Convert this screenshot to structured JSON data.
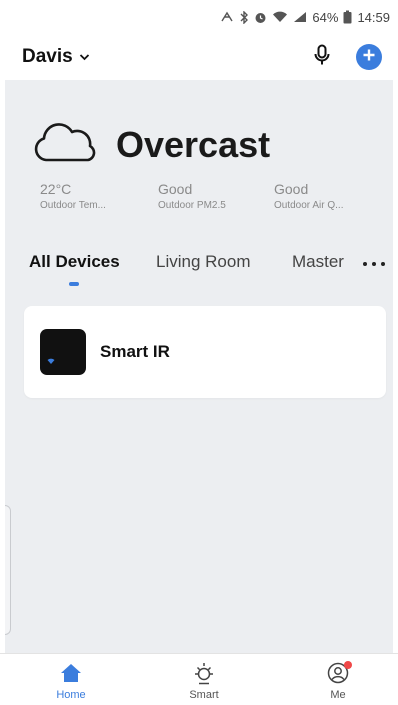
{
  "status_bar": {
    "battery_percent": "64%",
    "time": "14:59",
    "icons": [
      "nfc-icon",
      "bluetooth-icon",
      "alarm-icon",
      "wifi-icon",
      "signal-icon",
      "battery-icon"
    ]
  },
  "header": {
    "home_name": "Davis",
    "icons": [
      "chevron-down-icon",
      "microphone-icon",
      "plus-icon"
    ]
  },
  "weather": {
    "condition": "Overcast",
    "icon": "cloud-icon",
    "metrics": [
      {
        "value": "22°C",
        "caption": "Outdoor Tem..."
      },
      {
        "value": "Good",
        "caption": "Outdoor PM2.5"
      },
      {
        "value": "Good",
        "caption": "Outdoor Air Q..."
      }
    ]
  },
  "rooms": {
    "tabs": [
      "All Devices",
      "Living Room",
      "Master"
    ],
    "active_index": 0
  },
  "devices": [
    {
      "name": "Smart IR",
      "icon": "ir-remote-icon"
    }
  ],
  "nav": {
    "items": [
      {
        "label": "Home",
        "icon": "home-icon"
      },
      {
        "label": "Smart",
        "icon": "sun-icon"
      },
      {
        "label": "Me",
        "icon": "profile-icon"
      }
    ],
    "active_index": 0
  },
  "colors": {
    "accent": "#3b7ddd",
    "background": "#eceef1",
    "notification": "#f04848"
  }
}
